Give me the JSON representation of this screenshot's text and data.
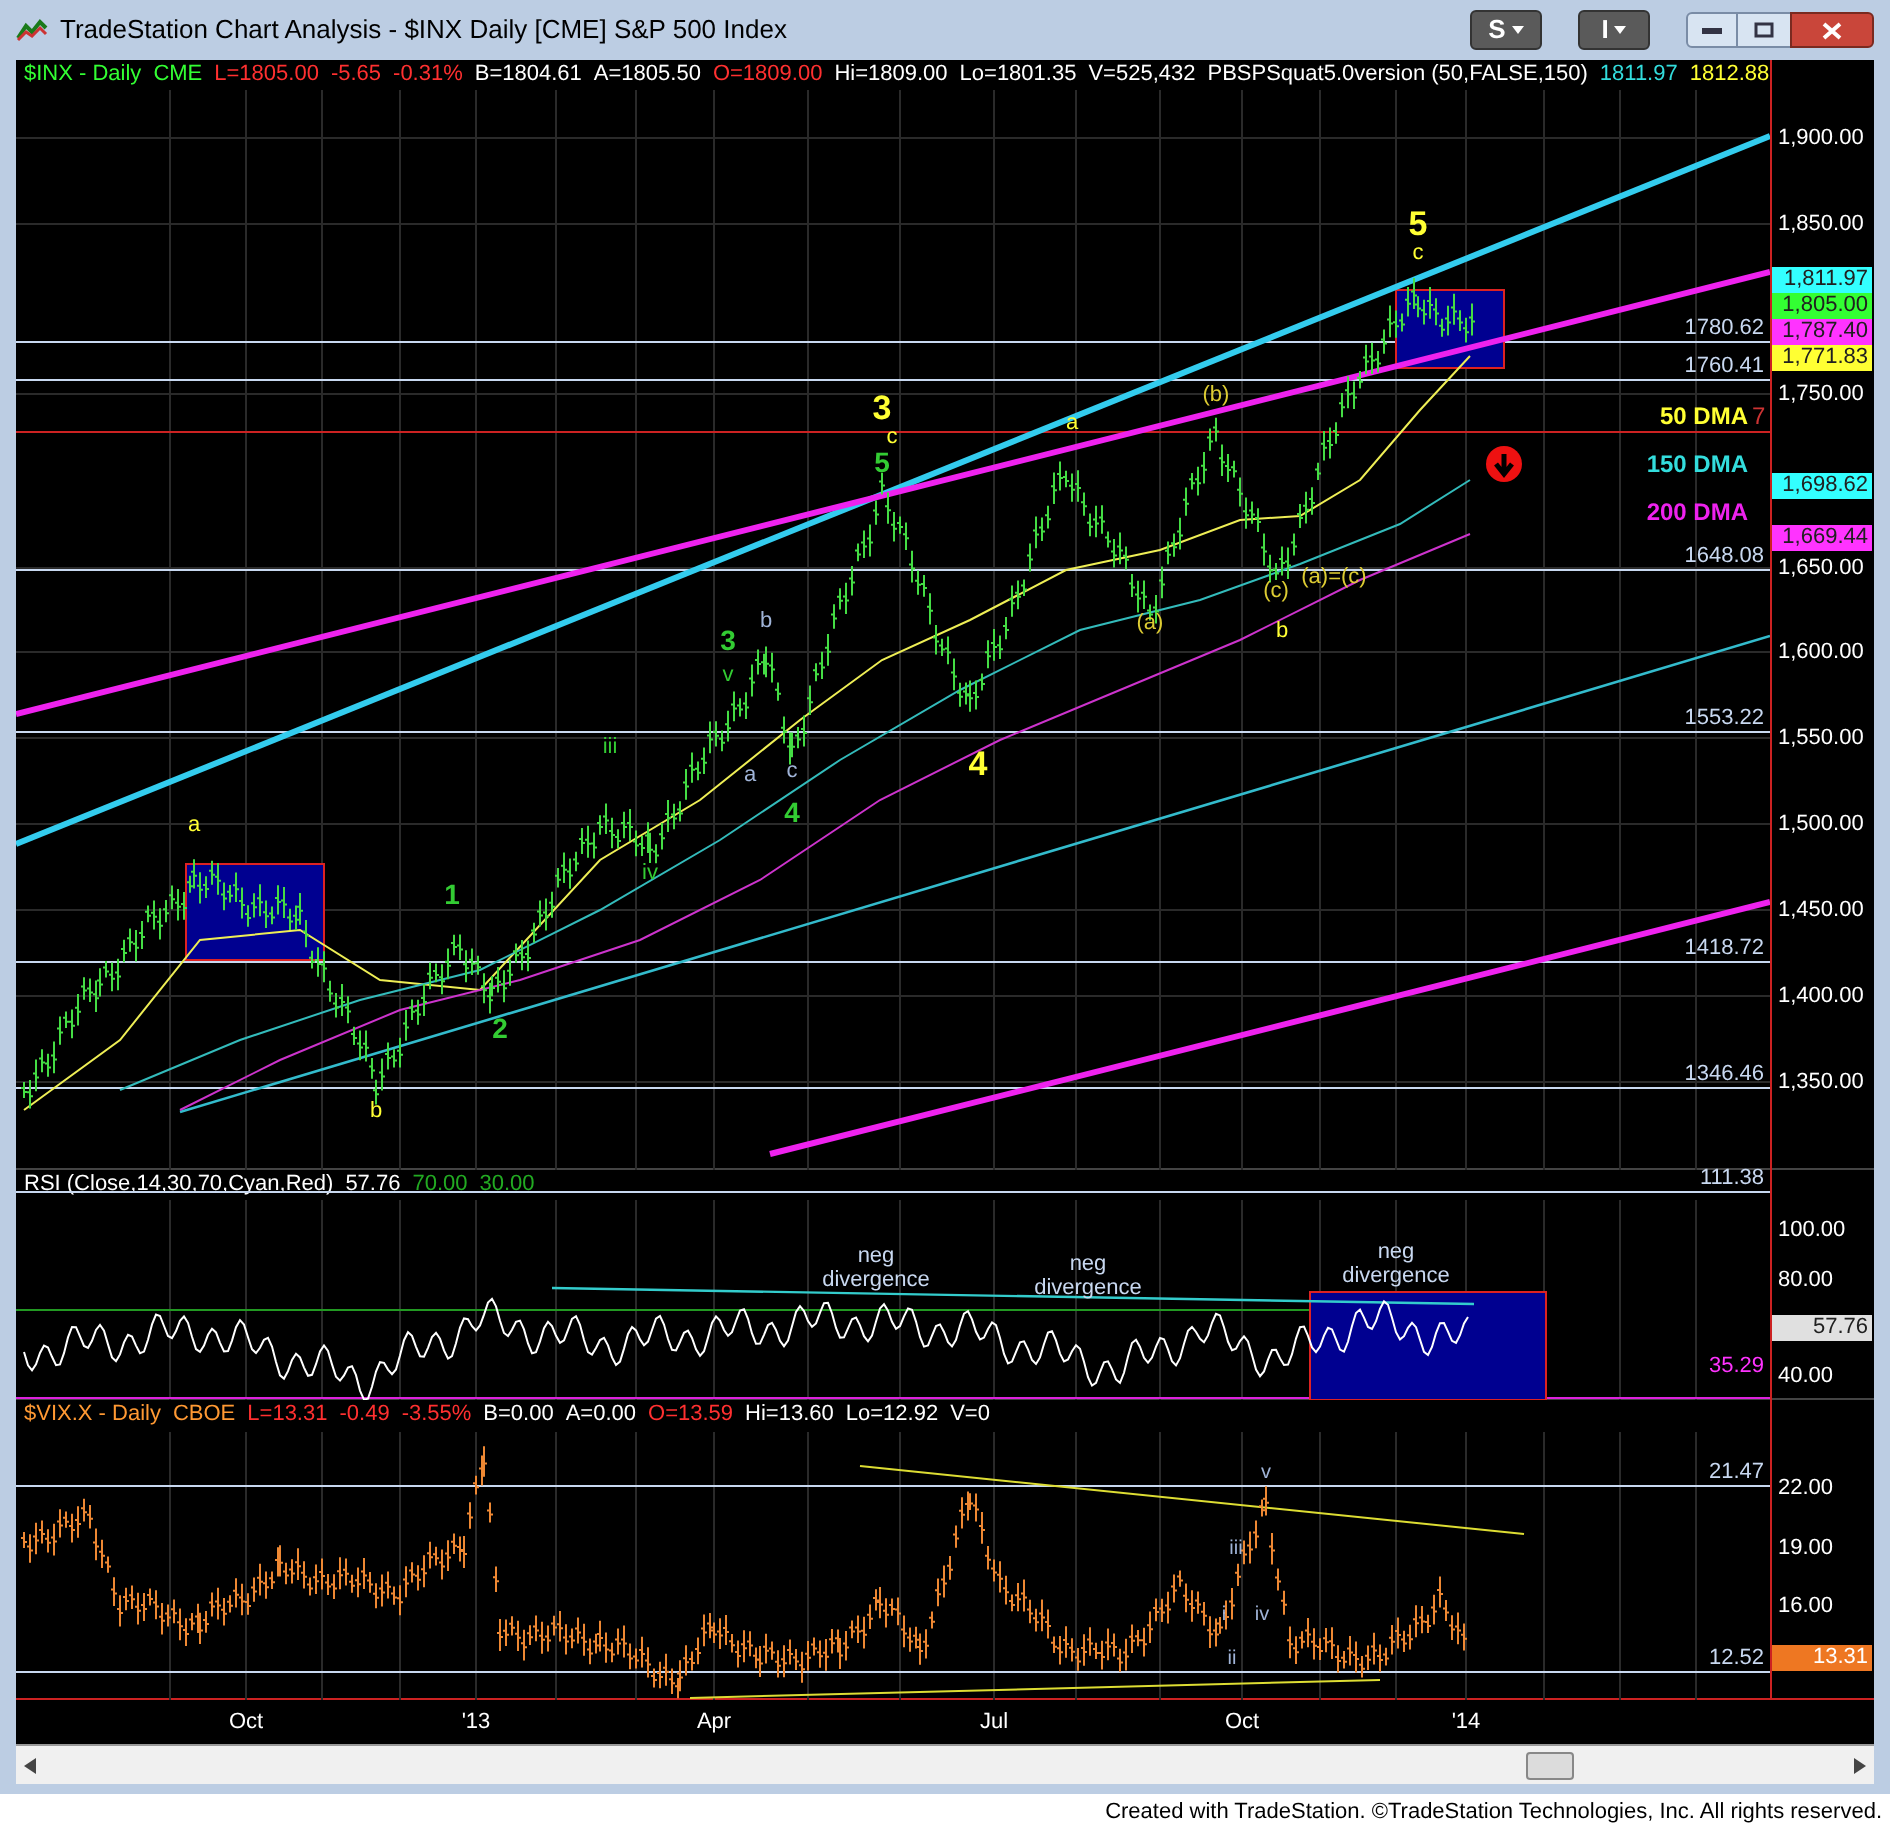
{
  "window": {
    "title": "TradeStation Chart Analysis - $INX Daily [CME] S&P 500 Index",
    "menu_buttons": [
      "S",
      "I"
    ]
  },
  "price_panel": {
    "legend": [
      {
        "text": "$INX - Daily",
        "color": "#33ff33"
      },
      {
        "text": "CME",
        "color": "#33ff33"
      },
      {
        "text": "L=1805.00",
        "color": "#ff3030"
      },
      {
        "text": "-5.65",
        "color": "#ff3030"
      },
      {
        "text": "-0.31%",
        "color": "#ff3030"
      },
      {
        "text": "B=1804.61",
        "color": "#ffffff"
      },
      {
        "text": "A=1805.50",
        "color": "#ffffff"
      },
      {
        "text": "O=1809.00",
        "color": "#ff3030"
      },
      {
        "text": "Hi=1809.00",
        "color": "#ffffff"
      },
      {
        "text": "Lo=1801.35",
        "color": "#ffffff"
      },
      {
        "text": "V=525,432",
        "color": "#ffffff"
      },
      {
        "text": "PBSPSquat5.0version (50,FALSE,150)",
        "color": "#ffffff"
      },
      {
        "text": "1811.97",
        "color": "#33dddd"
      },
      {
        "text": "1812.88",
        "color": "#ffff33"
      }
    ],
    "axis_labels": [
      "1,900.00",
      "1,850.00",
      "1,750.00",
      "1,650.00",
      "1,600.00",
      "1,550.00",
      "1,500.00",
      "1,450.00",
      "1,400.00",
      "1,350.00"
    ],
    "value_badges": [
      {
        "text": "1,811.97",
        "color": "#33ffff"
      },
      {
        "text": "1,805.00",
        "color": "#33ff33"
      },
      {
        "text": "1,787.40",
        "color": "#ff33ff"
      },
      {
        "text": "1,771.83",
        "color": "#ffff33"
      },
      {
        "text": "1,698.62",
        "color": "#33ffff"
      },
      {
        "text": "1,669.44",
        "color": "#ff33ff"
      }
    ],
    "level_lines": [
      "1780.62",
      "1760.41",
      "1648.08",
      "1553.22",
      "1418.72",
      "1346.46"
    ],
    "ma_labels": [
      {
        "text": "50 DMA",
        "color": "#ffff33"
      },
      {
        "text": "150 DMA",
        "color": "#33dddd"
      },
      {
        "text": "200 DMA",
        "color": "#ee22ee"
      }
    ],
    "cut_label": "7",
    "wave_labels": [
      {
        "text": "a",
        "color": "#ffff33",
        "kind": "minor"
      },
      {
        "text": "b",
        "color": "#ffff33",
        "kind": "minor"
      },
      {
        "text": "1",
        "color": "#33cc33",
        "kind": "intermediate"
      },
      {
        "text": "2",
        "color": "#33cc33",
        "kind": "intermediate"
      },
      {
        "text": "iii",
        "color": "#33cc33",
        "kind": "minor"
      },
      {
        "text": "iv",
        "color": "#33cc33",
        "kind": "minor"
      },
      {
        "text": "3",
        "color": "#33cc33",
        "kind": "intermediate"
      },
      {
        "text": "v",
        "color": "#33cc33",
        "kind": "minor"
      },
      {
        "text": "b",
        "color": "#a0b4d8",
        "kind": "minor"
      },
      {
        "text": "a",
        "color": "#a0b4d8",
        "kind": "minor"
      },
      {
        "text": "c",
        "color": "#a0b4d8",
        "kind": "minor"
      },
      {
        "text": "4",
        "color": "#33cc33",
        "kind": "intermediate"
      },
      {
        "text": "3",
        "color": "#ffff33",
        "kind": "major"
      },
      {
        "text": "c",
        "color": "#ffff33",
        "kind": "minor"
      },
      {
        "text": "5",
        "color": "#33cc33",
        "kind": "intermediate"
      },
      {
        "text": "4",
        "color": "#ffff33",
        "kind": "major"
      },
      {
        "text": "a",
        "color": "#ffff33",
        "kind": "minor"
      },
      {
        "text": "(b)",
        "color": "#ddcc33",
        "kind": "minor"
      },
      {
        "text": "(a)",
        "color": "#ddcc33",
        "kind": "minor"
      },
      {
        "text": "(c)",
        "color": "#ddcc33",
        "kind": "minor"
      },
      {
        "text": "(a)=(c)",
        "color": "#ddcc33",
        "kind": "minor"
      },
      {
        "text": "b",
        "color": "#ffff33",
        "kind": "minor"
      },
      {
        "text": "5",
        "color": "#ffff33",
        "kind": "major"
      },
      {
        "text": "c",
        "color": "#ffff33",
        "kind": "minor"
      }
    ]
  },
  "rsi_panel": {
    "legend": [
      {
        "text": "RSI (Close,14,30,70,Cyan,Red)",
        "color": "#ffffff"
      },
      {
        "text": "57.76",
        "color": "#ffffff"
      },
      {
        "text": "70.00",
        "color": "#22aa22"
      },
      {
        "text": "30.00",
        "color": "#22aa22"
      }
    ],
    "axis_labels": [
      "100.00",
      "80.00",
      "40.00"
    ],
    "level_lines": [
      {
        "text": "111.38",
        "color": "#c8d8f0"
      },
      {
        "text": "35.29",
        "color": "#ff33ff"
      }
    ],
    "value_badge": "57.76",
    "annotations": [
      "neg divergence",
      "neg divergence",
      "neg divergence"
    ]
  },
  "vix_panel": {
    "legend": [
      {
        "text": "$VIX.X - Daily",
        "color": "#ff9933"
      },
      {
        "text": "CBOE",
        "color": "#ff9933"
      },
      {
        "text": "L=13.31",
        "color": "#ff3030"
      },
      {
        "text": "-0.49",
        "color": "#ff3030"
      },
      {
        "text": "-3.55%",
        "color": "#ff3030"
      },
      {
        "text": "B=0.00",
        "color": "#ffffff"
      },
      {
        "text": "A=0.00",
        "color": "#ffffff"
      },
      {
        "text": "O=13.59",
        "color": "#ff3030"
      },
      {
        "text": "Hi=13.60",
        "color": "#ffffff"
      },
      {
        "text": "Lo=12.92",
        "color": "#ffffff"
      },
      {
        "text": "V=0",
        "color": "#ffffff"
      }
    ],
    "axis_labels": [
      "22.00",
      "19.00",
      "16.00"
    ],
    "level_lines": [
      "21.47",
      "12.52"
    ],
    "value_badge": "13.31",
    "wave_labels": [
      "v",
      "iii",
      "i",
      "iv",
      "ii"
    ]
  },
  "x_axis": [
    "Oct",
    "'13",
    "Apr",
    "Jul",
    "Oct",
    "'14"
  ],
  "footer": "Created with TradeStation. ©TradeStation Technologies, Inc. All rights reserved."
}
